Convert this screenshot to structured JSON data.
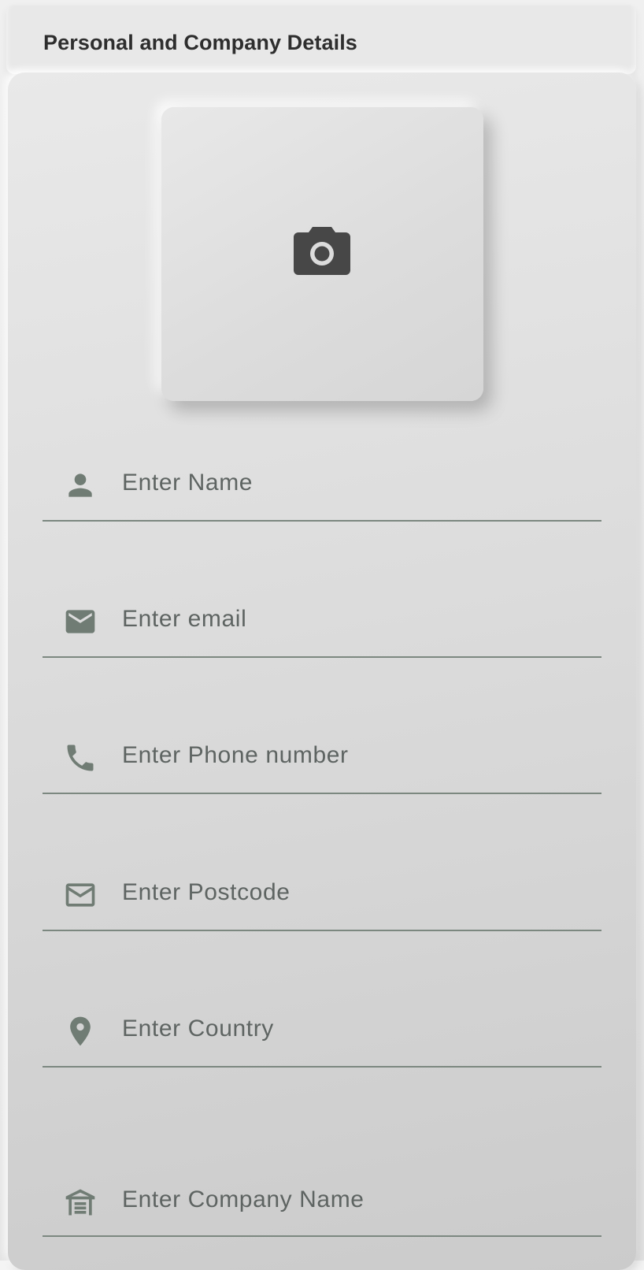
{
  "header": {
    "title": "Personal and Company Details"
  },
  "photo": {
    "icon": "camera-icon"
  },
  "fields": [
    {
      "name": "name-field",
      "icon": "person-icon",
      "placeholder": "Enter Name"
    },
    {
      "name": "email-field",
      "icon": "mail-filled-icon",
      "placeholder": "Enter email"
    },
    {
      "name": "phone-field",
      "icon": "phone-icon",
      "placeholder": "Enter Phone number"
    },
    {
      "name": "postcode-field",
      "icon": "mail-outline-icon",
      "placeholder": "Enter Postcode"
    },
    {
      "name": "country-field",
      "icon": "location-pin-icon",
      "placeholder": "Enter Country"
    },
    {
      "name": "company-name-field",
      "icon": "warehouse-icon",
      "placeholder": "Enter Company Name"
    }
  ],
  "colors": {
    "title": "#2e2e2e",
    "icon": "#707c74",
    "placeholder": "#5e6462",
    "underline": "#7c8880",
    "camera": "#474747"
  }
}
